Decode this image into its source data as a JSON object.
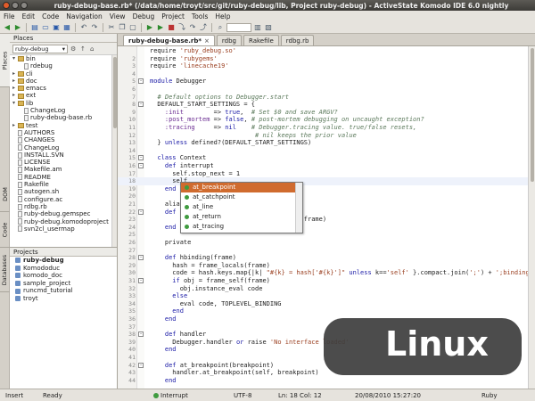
{
  "window": {
    "title": "ruby-debug-base.rb* (/data/home/troyt/src/git/ruby-debug/lib, Project ruby-debug) - ActiveState Komodo IDE 6.0 nightly"
  },
  "menu": [
    "File",
    "Edit",
    "Code",
    "Navigation",
    "View",
    "Debug",
    "Project",
    "Tools",
    "Help"
  ],
  "side_tabs": [
    "Places",
    "DOM",
    "Code",
    "Databases"
  ],
  "places": {
    "title": "Places",
    "combo_value": "ruby-debug",
    "tree": [
      {
        "label": "bin",
        "kind": "folder",
        "expanded": true,
        "indent": 1
      },
      {
        "label": "rdebug",
        "kind": "file",
        "indent": 2
      },
      {
        "label": "cli",
        "kind": "folder",
        "indent": 1
      },
      {
        "label": "doc",
        "kind": "folder",
        "indent": 1
      },
      {
        "label": "emacs",
        "kind": "folder",
        "indent": 1
      },
      {
        "label": "ext",
        "kind": "folder",
        "indent": 1
      },
      {
        "label": "lib",
        "kind": "folder",
        "expanded": true,
        "indent": 1
      },
      {
        "label": "ChangeLog",
        "kind": "file",
        "indent": 2
      },
      {
        "label": "ruby-debug-base.rb",
        "kind": "file",
        "indent": 2
      },
      {
        "label": "test",
        "kind": "folder",
        "indent": 1
      },
      {
        "label": "AUTHORS",
        "kind": "file",
        "indent": 1
      },
      {
        "label": "CHANGES",
        "kind": "file",
        "indent": 1
      },
      {
        "label": "ChangeLog",
        "kind": "file",
        "indent": 1
      },
      {
        "label": "INSTALL.SVN",
        "kind": "file",
        "indent": 1
      },
      {
        "label": "LICENSE",
        "kind": "file",
        "indent": 1
      },
      {
        "label": "Makefile.am",
        "kind": "file",
        "indent": 1
      },
      {
        "label": "README",
        "kind": "file",
        "indent": 1
      },
      {
        "label": "Rakefile",
        "kind": "file",
        "indent": 1
      },
      {
        "label": "autogen.sh",
        "kind": "file",
        "indent": 1
      },
      {
        "label": "configure.ac",
        "kind": "file",
        "indent": 1
      },
      {
        "label": "rdbg.rb",
        "kind": "file",
        "indent": 1
      },
      {
        "label": "ruby-debug.gemspec",
        "kind": "file",
        "indent": 1
      },
      {
        "label": "ruby-debug.komodoproject",
        "kind": "file",
        "indent": 1
      },
      {
        "label": "svn2cl_usermap",
        "kind": "file",
        "indent": 1
      }
    ]
  },
  "projects": {
    "title": "Projects",
    "items": [
      {
        "label": "ruby-debug",
        "bold": true
      },
      {
        "label": "Komododuc",
        "bold": false
      },
      {
        "label": "komodo_doc",
        "bold": false
      },
      {
        "label": "sample_project",
        "bold": false
      },
      {
        "label": "runcmd_tutorial",
        "bold": false
      },
      {
        "label": "troyt",
        "bold": false
      }
    ]
  },
  "editor_tabs": [
    {
      "label": "ruby-debug-base.rb*",
      "active": true
    },
    {
      "label": "rdbg",
      "active": false
    },
    {
      "label": "Rakefile",
      "active": false
    },
    {
      "label": "rdbg.rb",
      "active": false
    }
  ],
  "code_lines": [
    {
      "n": "",
      "html": "require <span class='str'>'ruby_debug.so'</span>"
    },
    {
      "n": "2",
      "html": "require <span class='str'>'rubygems'</span>"
    },
    {
      "n": "3",
      "html": "require <span class='str'>'linecache19'</span>"
    },
    {
      "n": "4",
      "html": ""
    },
    {
      "n": "5",
      "html": "<span class='kw'>module</span> Debugger",
      "fold": "-"
    },
    {
      "n": "6",
      "html": ""
    },
    {
      "n": "7",
      "html": "  <span class='cm'># Default options to Debugger.start</span>"
    },
    {
      "n": "8",
      "html": "  DEFAULT_START_SETTINGS = {",
      "fold": "-"
    },
    {
      "n": "9",
      "html": "    <span class='sym'>:init</span>        =&gt; <span class='kw'>true</span>,  <span class='cm'># Set $0 and save ARGV?</span>"
    },
    {
      "n": "10",
      "html": "    <span class='sym'>:post_mortem</span> =&gt; <span class='kw'>false</span>, <span class='cm'># post-mortem debugging on uncaught exception?</span>"
    },
    {
      "n": "11",
      "html": "    <span class='sym'>:tracing</span>     =&gt; <span class='kw'>nil</span>    <span class='cm'># Debugger.tracing value. true/false resets,</span>"
    },
    {
      "n": "12",
      "html": "                            <span class='cm'># nil keeps the prior value</span>"
    },
    {
      "n": "13",
      "html": "  } <span class='kw'>unless</span> defined?(DEFAULT_START_SETTINGS)"
    },
    {
      "n": "14",
      "html": ""
    },
    {
      "n": "15",
      "html": "  <span class='kw'>class</span> Context",
      "fold": "-"
    },
    {
      "n": "16",
      "html": "    <span class='kw'>def</span> interrupt",
      "fold": "-"
    },
    {
      "n": "17",
      "html": "      self.stop_next = 1"
    },
    {
      "n": "18",
      "html": "      self.",
      "cur": true
    },
    {
      "n": "19",
      "html": "    <span class='kw'>end</span>"
    },
    {
      "n": "20",
      "html": ""
    },
    {
      "n": "21",
      "html": "    alia"
    },
    {
      "n": "22",
      "html": "    <span class='kw'>def</span>",
      "fold": "-"
    },
    {
      "n": "23",
      "html": "                                         frame)"
    },
    {
      "n": "24",
      "html": "    <span class='kw'>end</span>"
    },
    {
      "n": "25",
      "html": ""
    },
    {
      "n": "26",
      "html": "    private"
    },
    {
      "n": "27",
      "html": ""
    },
    {
      "n": "28",
      "html": "    <span class='kw'>def</span> hbinding(frame)",
      "fold": "-"
    },
    {
      "n": "29",
      "html": "      hash = frame_locals(frame)"
    },
    {
      "n": "30",
      "html": "      code = hash.keys.map{|k| <span class='str'>\"#{k} = hash['#{k}']\"</span> <span class='kw'>unless</span> k==<span class='str'>'self'</span> }.compact.join(<span class='str'>';'</span>) + <span class='str'>';binding'</span>"
    },
    {
      "n": "31",
      "html": "      <span class='kw'>if</span> obj = frame_self(frame)",
      "fold": "-"
    },
    {
      "n": "32",
      "html": "        obj.instance_eval code"
    },
    {
      "n": "33",
      "html": "      <span class='kw'>else</span>"
    },
    {
      "n": "34",
      "html": "        eval code, TOPLEVEL_BINDING"
    },
    {
      "n": "35",
      "html": "      <span class='kw'>end</span>"
    },
    {
      "n": "36",
      "html": "    <span class='kw'>end</span>"
    },
    {
      "n": "37",
      "html": ""
    },
    {
      "n": "38",
      "html": "    <span class='kw'>def</span> handler",
      "fold": "-"
    },
    {
      "n": "39",
      "html": "      Debugger.handler <span class='kw'>or</span> raise <span class='str'>'No interface loaded'</span>"
    },
    {
      "n": "40",
      "html": "    <span class='kw'>end</span>"
    },
    {
      "n": "41",
      "html": ""
    },
    {
      "n": "42",
      "html": "    <span class='kw'>def</span> at_breakpoint(breakpoint)",
      "fold": "-"
    },
    {
      "n": "43",
      "html": "      handler.at_breakpoint(self, breakpoint)"
    },
    {
      "n": "44",
      "html": "    <span class='kw'>end</span>"
    }
  ],
  "autocomplete": [
    "at_breakpoint",
    "at_catchpoint",
    "at_line",
    "at_return",
    "at_tracing"
  ],
  "badge": "Linux",
  "status": {
    "mode": "Insert",
    "state": "Ready",
    "debug": "Interrupt",
    "encoding": "UTF-8",
    "position": "Ln: 18 Col: 12",
    "datetime": "20/08/2010 15:27:20",
    "language": "Ruby"
  },
  "colors": {
    "accent_selected": "#d06b2e",
    "keyword": "#1a1aa6",
    "string": "#9a3e1f"
  }
}
